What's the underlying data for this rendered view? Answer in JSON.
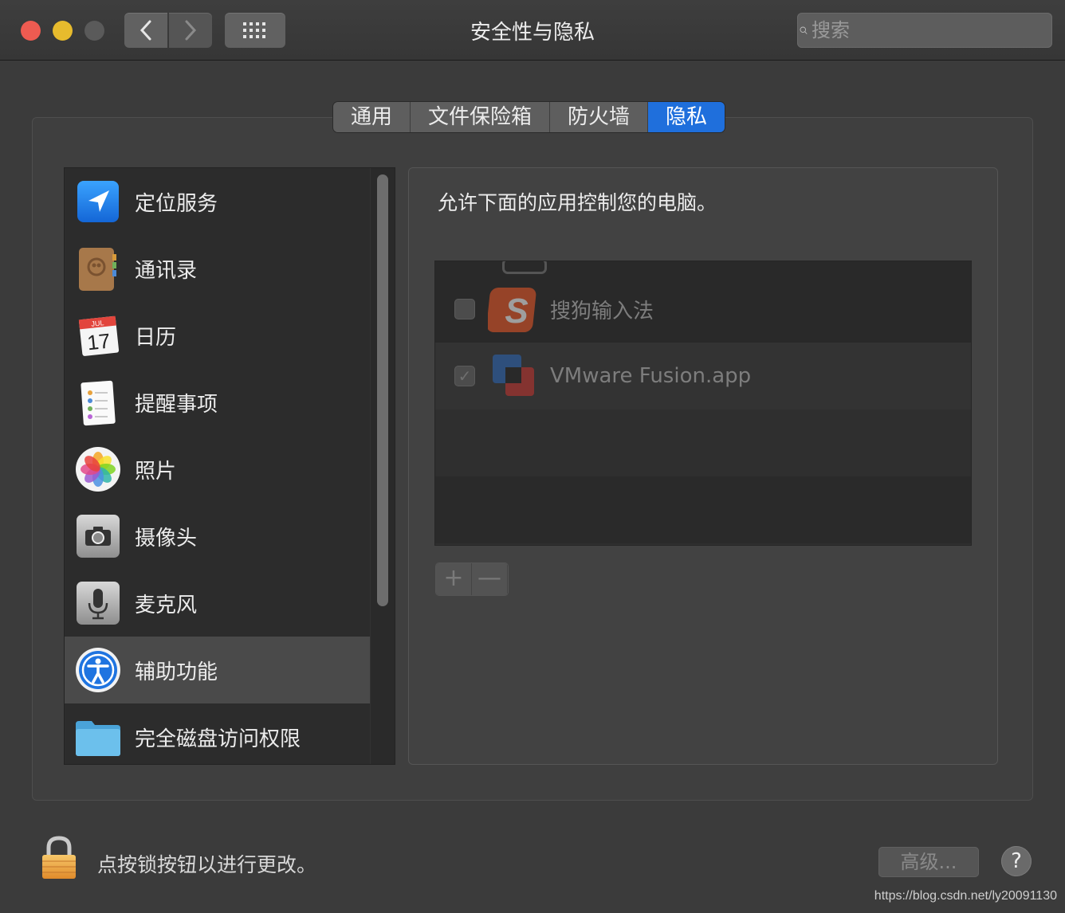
{
  "window": {
    "title": "安全性与隐私",
    "search_placeholder": "搜索"
  },
  "tabs": [
    {
      "label": "通用",
      "active": false
    },
    {
      "label": "文件保险箱",
      "active": false
    },
    {
      "label": "防火墙",
      "active": false
    },
    {
      "label": "隐私",
      "active": true
    }
  ],
  "sidebar": {
    "items": [
      {
        "label": "定位服务",
        "icon": "location-arrow-icon"
      },
      {
        "label": "通讯录",
        "icon": "contacts-icon"
      },
      {
        "label": "日历",
        "icon": "calendar-icon",
        "month": "JUL",
        "day": "17"
      },
      {
        "label": "提醒事项",
        "icon": "reminders-icon"
      },
      {
        "label": "照片",
        "icon": "photos-icon"
      },
      {
        "label": "摄像头",
        "icon": "camera-icon"
      },
      {
        "label": "麦克风",
        "icon": "microphone-icon"
      },
      {
        "label": "辅助功能",
        "icon": "accessibility-icon",
        "selected": true
      },
      {
        "label": "完全磁盘访问权限",
        "icon": "folder-icon"
      }
    ]
  },
  "privacy_pane": {
    "description": "允许下面的应用控制您的电脑。",
    "apps": [
      {
        "name": "搜狗输入法",
        "checked": false,
        "icon": "sogou-icon"
      },
      {
        "name": "VMware Fusion.app",
        "checked": true,
        "icon": "vmware-icon"
      }
    ],
    "add_label": "+",
    "remove_label": "—"
  },
  "footer": {
    "lock_text": "点按锁按钮以进行更改。",
    "advanced_label": "高级...",
    "help_label": "?"
  },
  "watermark": "https://blog.csdn.net/ly20091130",
  "colors": {
    "accent": "#1f6fdc",
    "close": "#ee5b51",
    "minimize": "#e7bb2d"
  }
}
